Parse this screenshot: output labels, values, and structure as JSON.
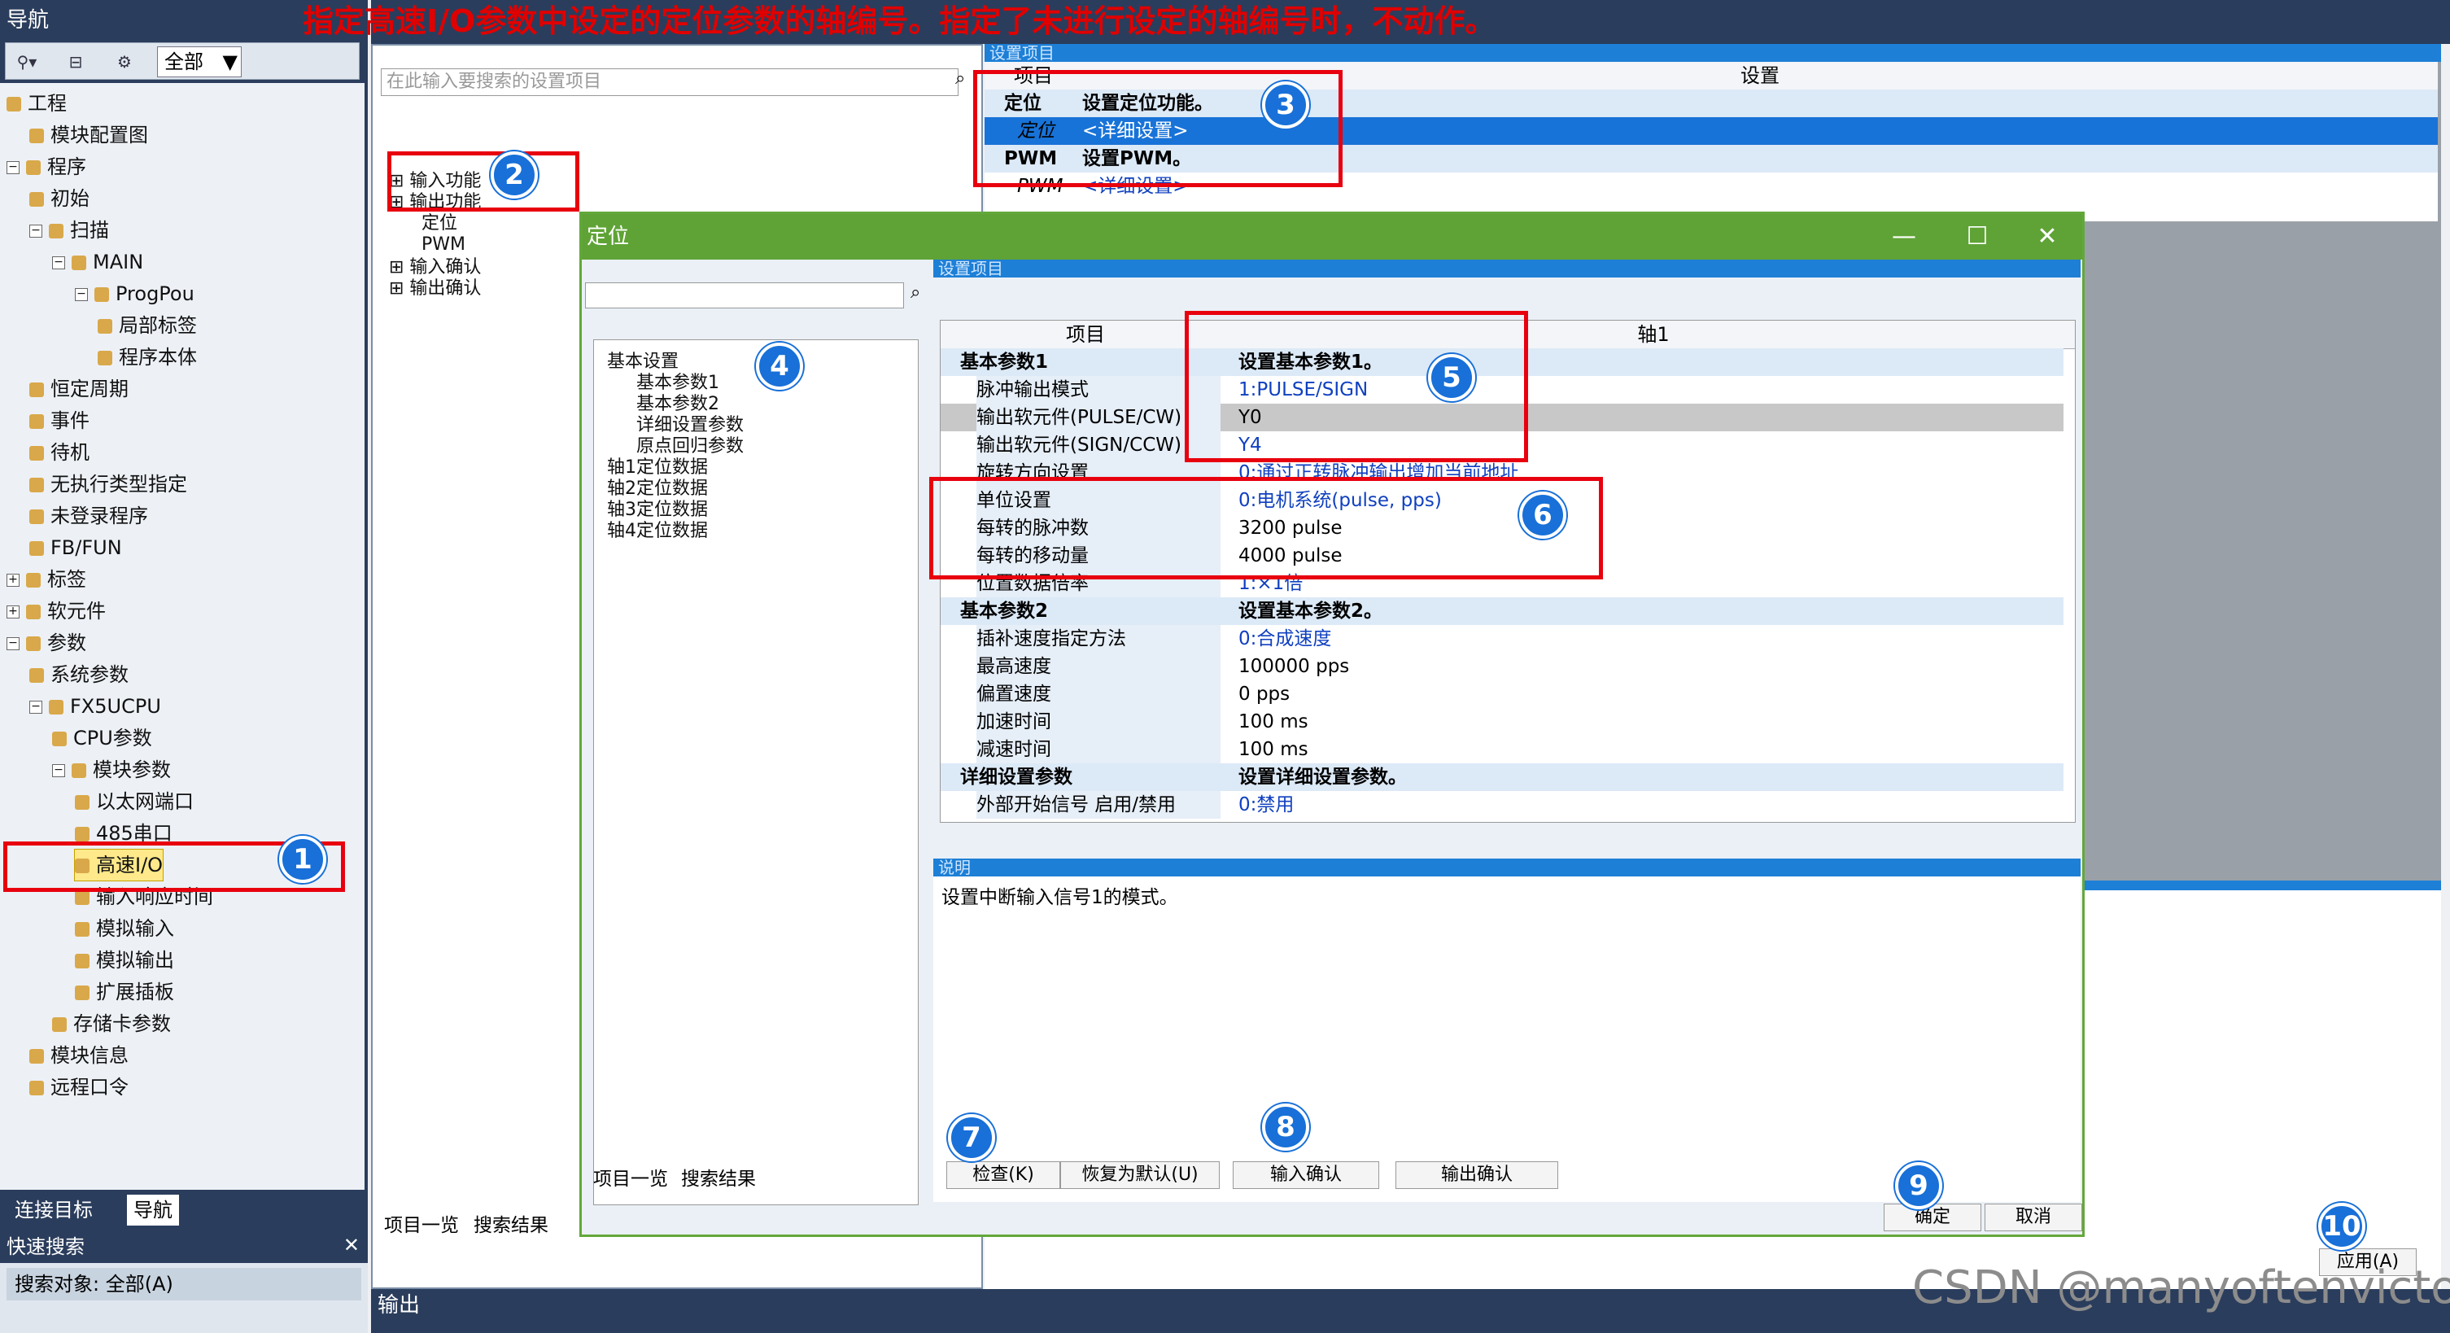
{
  "nav": {
    "title": "导航",
    "filter_value": "全部",
    "tabs": [
      "连接目标",
      "导航"
    ]
  },
  "tree": [
    "工程",
    "模块配置图",
    "程序",
    "初始",
    "扫描",
    "MAIN",
    "ProgPou",
    "局部标签",
    "程序本体",
    "恒定周期",
    "事件",
    "待机",
    "无执行类型指定",
    "未登录程序",
    "FB/FUN",
    "标签",
    "软元件",
    "参数",
    "系统参数",
    "FX5UCPU",
    "CPU参数",
    "模块参数",
    "以太网端口",
    "485串口",
    "高速I/O",
    "输入响应时间",
    "模拟输入",
    "模拟输出",
    "扩展插板",
    "存储卡参数",
    "模块信息",
    "远程口令"
  ],
  "quick_search": {
    "title": "快速搜索",
    "target_label": "搜索对象: 全部(A)"
  },
  "annotation": "指定高速I/O参数中设定的定位参数的轴编号。指定了未进行设定的轴编号时，不动作。",
  "left_panel": {
    "search_placeholder": "在此输入要搜索的设置项目",
    "tree": [
      "输入功能",
      "输出功能",
      "定位",
      "PWM",
      "输入确认",
      "输出确认"
    ],
    "tabs": [
      "项目一览",
      "搜索结果"
    ]
  },
  "top_grid": {
    "section": "设置项目",
    "col_item": "项目",
    "col_setting": "设置",
    "rows": [
      {
        "name": "定位",
        "value": "设置定位功能。"
      },
      {
        "name": "定位",
        "value": "<详细设置>"
      },
      {
        "name": "PWM",
        "value": "设置PWM。"
      },
      {
        "name": "PWM",
        "value": "<详细设置>"
      }
    ]
  },
  "dialog": {
    "title": "定位",
    "section": "设置项目",
    "tree": [
      "基本设置",
      "基本参数1",
      "基本参数2",
      "详细设置参数",
      "原点回归参数",
      "轴1定位数据",
      "轴2定位数据",
      "轴3定位数据",
      "轴4定位数据"
    ],
    "tabs": [
      "项目一览",
      "搜索结果"
    ],
    "col_item": "项目",
    "col_axis": "轴1",
    "rows": [
      {
        "name": "基本参数1",
        "value": "设置基本参数1。",
        "group": true
      },
      {
        "name": "脉冲输出模式",
        "value": "1:PULSE/SIGN"
      },
      {
        "name": "输出软元件(PULSE/CW)",
        "value": "Y0"
      },
      {
        "name": "输出软元件(SIGN/CCW)",
        "value": "Y4"
      },
      {
        "name": "旋转方向设置",
        "value": "0:通过正转脉冲输出增加当前地址"
      },
      {
        "name": "单位设置",
        "value": "0:电机系统(pulse, pps)"
      },
      {
        "name": "每转的脉冲数",
        "value": "3200 pulse"
      },
      {
        "name": "每转的移动量",
        "value": "4000 pulse"
      },
      {
        "name": "位置数据倍率",
        "value": "1:×1倍"
      },
      {
        "name": "基本参数2",
        "value": "设置基本参数2。",
        "group": true
      },
      {
        "name": "插补速度指定方法",
        "value": "0:合成速度"
      },
      {
        "name": "最高速度",
        "value": "100000 pps"
      },
      {
        "name": "偏置速度",
        "value": "0 pps"
      },
      {
        "name": "加速时间",
        "value": "100 ms"
      },
      {
        "name": "减速时间",
        "value": "100 ms"
      },
      {
        "name": "详细设置参数",
        "value": "设置详细设置参数。",
        "group": true
      },
      {
        "name": "外部开始信号 启用/禁用",
        "value": "0:禁用"
      }
    ],
    "desc_title": "说明",
    "desc_text": "设置中断输入信号1的模式。",
    "buttons": {
      "check": "检查(K)",
      "default": "恢复为默认(U)",
      "in_confirm": "输入确认",
      "out_confirm": "输出确认",
      "ok": "确定",
      "cancel": "取消"
    }
  },
  "apply_button": "应用(A)",
  "output_title": "输出",
  "watermark": "CSDN @manyoftenvictory",
  "badges": [
    "1",
    "2",
    "3",
    "4",
    "5",
    "6",
    "7",
    "8",
    "9",
    "10"
  ],
  "colors": {
    "nav_bg": "#2b3d5c",
    "title_green": "#5fa336",
    "red": "#e8000e",
    "badge": "#1870d8"
  }
}
